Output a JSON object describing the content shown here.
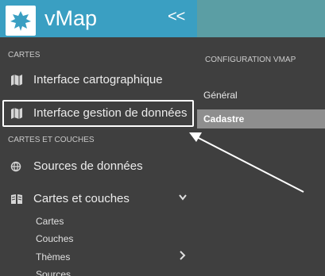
{
  "app": {
    "title": "vMap",
    "collapse_label": "<<"
  },
  "sidebar": {
    "sections": [
      {
        "label": "CARTES"
      },
      {
        "label": "CARTES ET COUCHES"
      }
    ],
    "items": [
      {
        "label": "Interface cartographique",
        "icon": "map-icon"
      },
      {
        "label": "Interface gestion de données",
        "icon": "map-icon",
        "highlighted": true
      },
      {
        "label": "Sources de données",
        "icon": "globe-icon"
      },
      {
        "label": "Cartes et couches",
        "icon": "book-map-icon",
        "expanded": true
      }
    ],
    "subitems": [
      {
        "label": "Cartes"
      },
      {
        "label": "Couches"
      },
      {
        "label": "Thèmes",
        "has_children": true
      },
      {
        "label": "Sources"
      }
    ]
  },
  "config_panel": {
    "title": "CONFIGURATION VMAP",
    "items": [
      {
        "label": "Général"
      },
      {
        "label": "Cadastre",
        "active": true
      }
    ]
  },
  "colors": {
    "header": "#3a9fc2",
    "sidebar": "#3f3f3f",
    "active_item": "#8e8e8e"
  }
}
